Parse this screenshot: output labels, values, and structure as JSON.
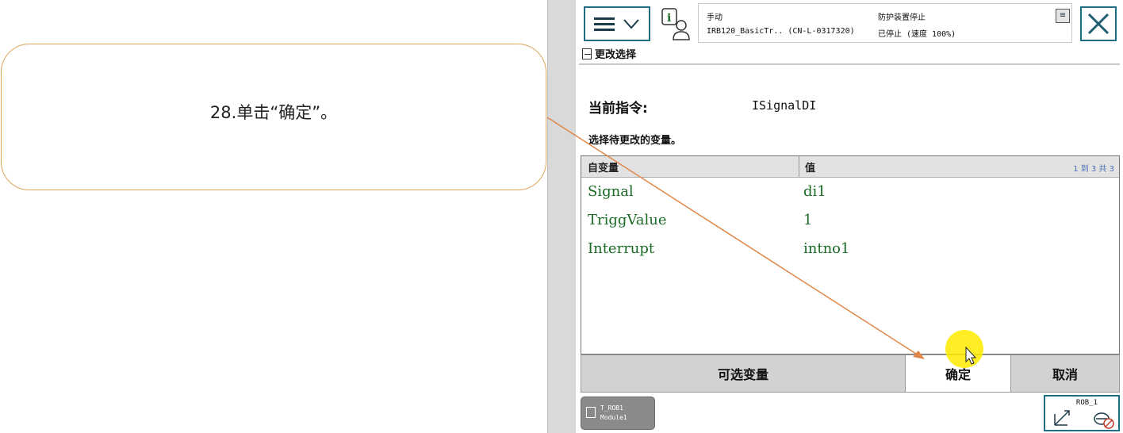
{
  "callout": {
    "text": "28.单击“确定”。"
  },
  "header": {
    "mode": "手动",
    "controller": "IRB120_BasicTr.. (CN-L-0317320)",
    "safety_state": "防护装置停止",
    "run_state": "已停止 (速度 100%)"
  },
  "page": {
    "breadcrumb": "更改选择",
    "current_instruction_label": "当前指令:",
    "current_instruction_value": "ISignalDI",
    "select_prompt": "选择待更改的变量。"
  },
  "table": {
    "headers": [
      "自变量",
      "值"
    ],
    "pager": "1 到 3 共 3",
    "rows": [
      {
        "name": "Signal",
        "value": "di1"
      },
      {
        "name": "TriggValue",
        "value": "1"
      },
      {
        "name": "Interrupt",
        "value": "intno1"
      }
    ]
  },
  "buttons": {
    "optional_vars": "可选变量",
    "ok": "确定",
    "cancel": "取消"
  },
  "taskbar": {
    "task_line1": "T_ROB1",
    "task_line2": "Module1",
    "robot": "ROB_1"
  },
  "colors": {
    "accent": "#1f6f84",
    "value_text": "#1a6b25",
    "callout_border": "#e0a45a",
    "arrow": "#e0864a",
    "cursor_highlight": "#ffeb00"
  }
}
